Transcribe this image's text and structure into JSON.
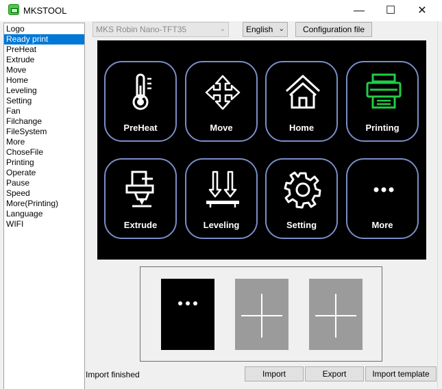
{
  "window": {
    "title": "MKSTOOL",
    "minimize_glyph": "—",
    "maximize_glyph": "☐",
    "close_glyph": "✕"
  },
  "sidebar": {
    "items": [
      {
        "label": "Logo"
      },
      {
        "label": "Ready print",
        "selected": true
      },
      {
        "label": "PreHeat"
      },
      {
        "label": "Extrude"
      },
      {
        "label": "Move"
      },
      {
        "label": "Home"
      },
      {
        "label": "Leveling"
      },
      {
        "label": "Setting"
      },
      {
        "label": "Fan"
      },
      {
        "label": "Filchange"
      },
      {
        "label": "FileSystem"
      },
      {
        "label": "More"
      },
      {
        "label": "ChoseFile"
      },
      {
        "label": "Printing"
      },
      {
        "label": "Operate"
      },
      {
        "label": "Pause"
      },
      {
        "label": "Speed"
      },
      {
        "label": "More(Printing)"
      },
      {
        "label": "Language"
      },
      {
        "label": "WIFI"
      }
    ]
  },
  "toolbar": {
    "board_select": "MKS Robin Nano-TFT35",
    "language_select": "English",
    "config_button": "Configuration file"
  },
  "screen": {
    "tiles": [
      {
        "label": "PreHeat",
        "icon": "thermometer-icon",
        "color": "#ffffff"
      },
      {
        "label": "Move",
        "icon": "move-arrows-icon",
        "color": "#ffffff"
      },
      {
        "label": "Home",
        "icon": "home-icon",
        "color": "#ffffff"
      },
      {
        "label": "Printing",
        "icon": "printer-icon",
        "color": "#22cc44"
      },
      {
        "label": "Extrude",
        "icon": "extruder-icon",
        "color": "#ffffff"
      },
      {
        "label": "Leveling",
        "icon": "leveling-icon",
        "color": "#ffffff"
      },
      {
        "label": "Setting",
        "icon": "gear-icon",
        "color": "#ffffff"
      },
      {
        "label": "More",
        "icon": "more-dots-icon",
        "color": "#ffffff"
      }
    ],
    "border_color": "#7b8ec8"
  },
  "preview": {
    "slots": [
      {
        "icon": "more-dots-icon",
        "background": "#000000"
      },
      {
        "icon": "plus-icon",
        "background": "#9b9b9b"
      },
      {
        "icon": "plus-icon",
        "background": "#9b9b9b"
      }
    ]
  },
  "status": {
    "text": "Import finished"
  },
  "bottom_buttons": {
    "import": "Import",
    "export": "Export",
    "import_template": "Import template"
  }
}
